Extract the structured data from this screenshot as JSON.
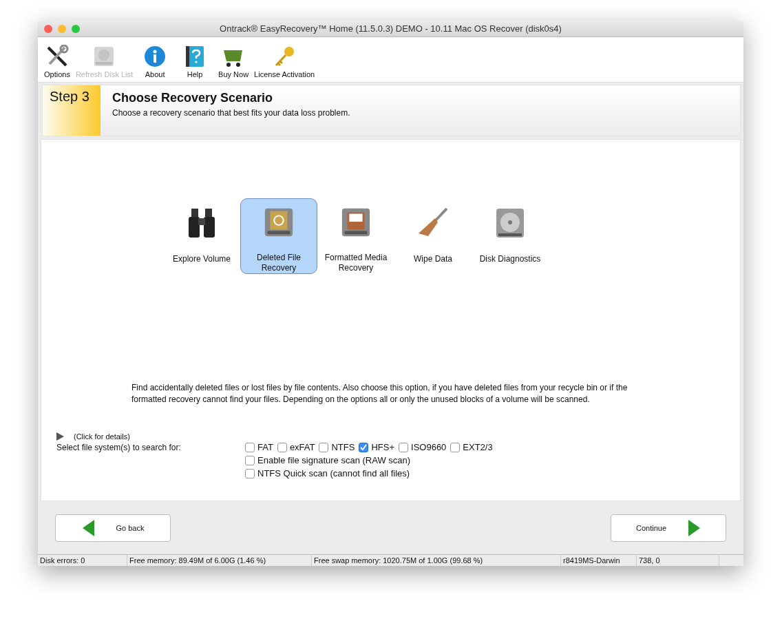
{
  "window": {
    "title": "Ontrack® EasyRecovery™ Home (11.5.0.3) DEMO - 10.11 Mac OS Recover (disk0s4)"
  },
  "toolbar": [
    {
      "kind": "tools",
      "label": "Options",
      "disabled": false
    },
    {
      "kind": "disk",
      "label": "Refresh Disk List",
      "disabled": true
    },
    {
      "kind": "info",
      "label": "About",
      "disabled": false
    },
    {
      "kind": "book",
      "label": "Help",
      "disabled": false
    },
    {
      "kind": "cart",
      "label": "Buy Now",
      "disabled": false
    },
    {
      "kind": "key",
      "label": "License Activation",
      "disabled": false
    }
  ],
  "step": {
    "badge": "Step 3",
    "title": "Choose Recovery Scenario",
    "subtitle": "Choose a recovery scenario that best fits your data loss problem."
  },
  "scenarios": [
    {
      "kind": "binoculars",
      "label": "Explore Volume",
      "selected": false
    },
    {
      "kind": "recycle",
      "label": "Deleted File Recovery",
      "selected": true
    },
    {
      "kind": "tray",
      "label": "Formatted Media Recovery",
      "selected": false
    },
    {
      "kind": "broom",
      "label": "Wipe Data",
      "selected": false
    },
    {
      "kind": "harddisk",
      "label": "Disk Diagnostics",
      "selected": false
    }
  ],
  "description": "Find accidentally deleted files or lost files by file contents. Also choose this option, if you have deleted files from your recycle bin or if the formatted recovery cannot find your files. Depending on the options all or only the unused blocks of a volume will be scanned.",
  "details": {
    "label": "(Click for details)",
    "expanded": false
  },
  "filesystems": {
    "label": "Select file system(s) to search for:",
    "types": [
      {
        "label": "FAT",
        "checked": false
      },
      {
        "label": "exFAT",
        "checked": false
      },
      {
        "label": "NTFS",
        "checked": false
      },
      {
        "label": "HFS+",
        "checked": true
      },
      {
        "label": "ISO9660",
        "checked": false
      },
      {
        "label": "EXT2/3",
        "checked": false
      }
    ],
    "options": [
      {
        "label": "Enable file signature scan (RAW scan)",
        "checked": false
      },
      {
        "label": "NTFS Quick scan (cannot find all files)",
        "checked": false
      }
    ]
  },
  "buttons": {
    "back": "Go back",
    "continue": "Continue"
  },
  "status_bar": [
    "Disk errors: 0",
    "Free memory: 89.49M of 6.00G (1.46 %)",
    "Free swap memory: 1020.75M of 1.00G (99.68 %)",
    "r8419MS-Darwin",
    "738, 0"
  ]
}
